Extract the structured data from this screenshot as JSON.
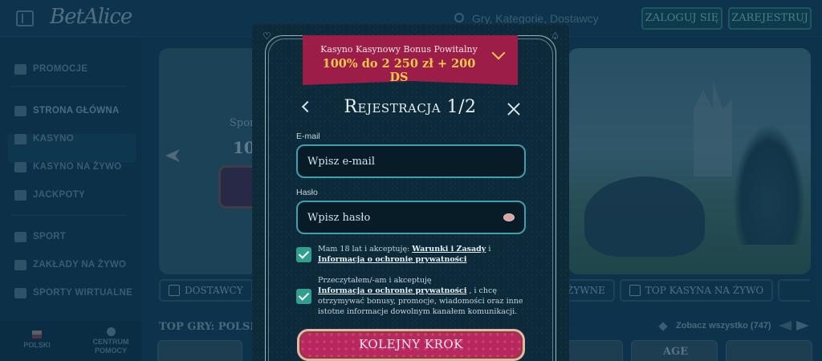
{
  "header": {
    "logo": "BetAlice",
    "search_placeholder": "Gry, Kategorie, Dostawcy",
    "login_label": "ZALOGUJ SIĘ",
    "register_label": "ZAREJESTRUJ"
  },
  "sidebar": {
    "items": [
      {
        "label": "PROMOCJE",
        "icon": "gift-icon"
      },
      {
        "label": "STRONA GŁÓWNA",
        "icon": "home-icon"
      },
      {
        "label": "KASYNO",
        "icon": "slot-icon"
      },
      {
        "label": "KASYNO NA ŻYWO",
        "icon": "cards-icon"
      },
      {
        "label": "JACKPOTY",
        "icon": "clover-icon"
      },
      {
        "label": "SPORT",
        "icon": "ball-icon"
      },
      {
        "label": "ZAKŁADY NA ŻYWO",
        "icon": "live-icon"
      },
      {
        "label": "SPORTY WIRTUALNE",
        "icon": "virtual-icon"
      }
    ],
    "language": "POLSKI",
    "help_line1": "CENTRUM",
    "help_line2": "POMOCY"
  },
  "banners": {
    "left_text1": "Spor",
    "left_text2": "100"
  },
  "tabs": {
    "providers": "DOSTAWCY",
    "live_partial": "ŻYWNE",
    "top_live": "TOP KASYNA NA ŻYWO"
  },
  "section": {
    "title": "TOP GRY: POLSKA",
    "see_all": "Zobacz wszystko (747)",
    "card_label": "AGE"
  },
  "modal": {
    "bonus_line1": "Kasyno Kasynowy Bonus Powitalny",
    "bonus_line2": "100% do 2 250 zł + 200 DS",
    "title": "Rejestracja 1/2",
    "email_label": "E-mail",
    "email_placeholder": "Wpisz e-mail",
    "password_label": "Hasło",
    "password_placeholder": "Wpisz hasło",
    "consent1_prefix": "Mam 18 lat i akceptuję: ",
    "consent1_link1": "Warunki i Zasady",
    "consent1_mid": " i ",
    "consent1_link2": "Informacja o ochronie prywatności",
    "consent1_checked": true,
    "consent2_prefix": "Przeczytałem/-am i akceptuję ",
    "consent2_link": "Informacja o ochronie prywatności",
    "consent2_suffix": " , i chcę otrzymywać bonusy, promocje, wiadomości oraz inne istotne informacje dowolnym kanałem komunikacji.",
    "consent2_checked": true,
    "next_label": "KOLEJNY KROK"
  },
  "colors": {
    "background": "#0f3a52",
    "modal_bg": "#0d2a3b",
    "bonus_bg": "#9c1d48",
    "bonus_amount": "#f2c94c",
    "input_border": "#3f9fae",
    "checkbox": "#2fa08e",
    "next_button": "#b7285e"
  }
}
